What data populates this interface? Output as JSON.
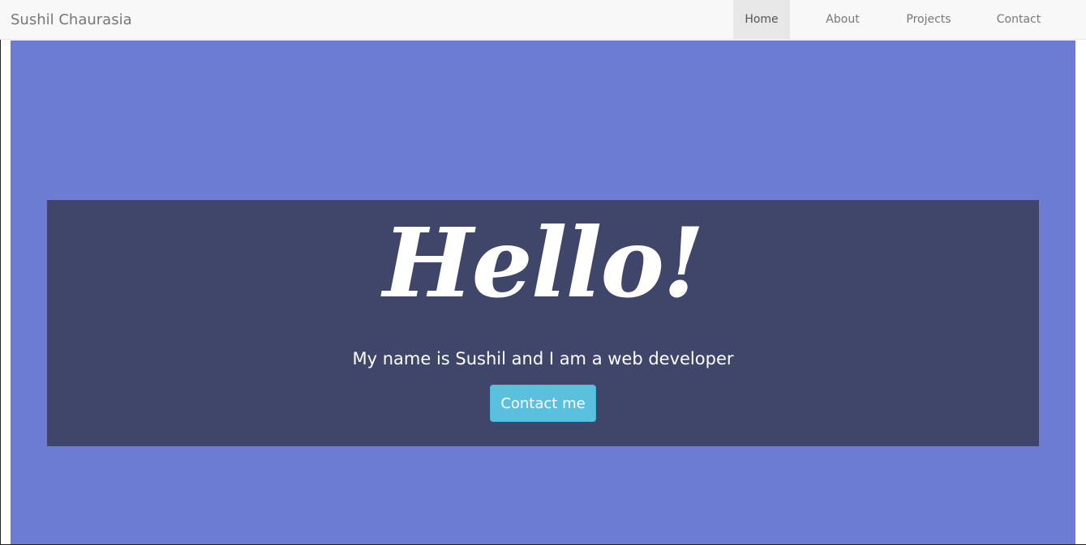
{
  "navbar": {
    "brand": "Sushil Chaurasia",
    "items": [
      {
        "label": "Home",
        "active": true
      },
      {
        "label": "About",
        "active": false
      },
      {
        "label": "Projects",
        "active": false
      },
      {
        "label": "Contact",
        "active": false
      }
    ]
  },
  "hero": {
    "heading": "Hello!",
    "tagline": "My name is Sushil and I am a web developer",
    "cta_label": "Contact me"
  },
  "colors": {
    "hero_bg": "#6b7cd2",
    "jumbotron_bg": "#3f4669",
    "button_bg": "#5bc0de",
    "navbar_bg": "#f8f8f8"
  }
}
